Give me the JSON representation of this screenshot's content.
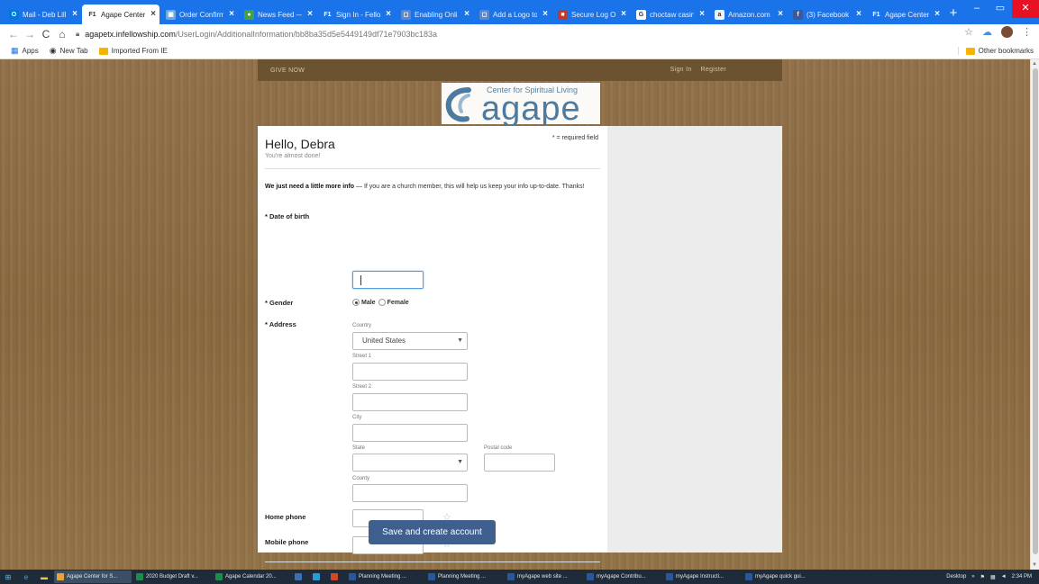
{
  "browser": {
    "tabs": [
      {
        "label": "Mail - Deb Lill",
        "icon_color": "#0078d4",
        "icon_char": "O"
      },
      {
        "label": "Agape Center f",
        "icon_color": "#ffffff",
        "icon_char": "F1",
        "active": true
      },
      {
        "label": "Order Confirm",
        "icon_color": "#6fa8dc",
        "icon_char": "▣"
      },
      {
        "label": "News Feed —",
        "icon_color": "#43a047",
        "icon_char": "●"
      },
      {
        "label": "Sign In - Fello",
        "icon_color": "#1a73e8",
        "icon_char": "F1"
      },
      {
        "label": "Enabling Onli",
        "icon_color": "#5f87c8",
        "icon_char": "◻"
      },
      {
        "label": "Add a Logo to",
        "icon_color": "#5f87c8",
        "icon_char": "◻"
      },
      {
        "label": "Secure Log Of",
        "icon_color": "#c0392b",
        "icon_char": "■"
      },
      {
        "label": "choctaw casin",
        "icon_color": "#ffffff",
        "icon_char": "G"
      },
      {
        "label": "Amazon.com",
        "icon_color": "#f3f3f3",
        "icon_char": "a"
      },
      {
        "label": "(3) Facebook",
        "icon_color": "#3b5998",
        "icon_char": "f"
      },
      {
        "label": "Agape Center",
        "icon_color": "#1a73e8",
        "icon_char": "F1"
      }
    ],
    "new_tab": "+",
    "window_controls": {
      "minimize": "–",
      "maximize": "▭",
      "close": "✕"
    },
    "nav": {
      "back": "←",
      "forward": "→",
      "reload": "C",
      "home": "⌂"
    },
    "url_host": "agapetx.infellowship.com",
    "url_path": "/UserLogin/AdditionalInformation/bb8ba35d5e5449149df71e7903bc183a",
    "bookmarks": [
      {
        "label": "Apps",
        "icon": "apps-grid-icon"
      },
      {
        "label": "New Tab",
        "icon": "globe-icon"
      },
      {
        "label": "Imported From IE",
        "icon": "folder-icon"
      }
    ],
    "other_bookmarks": "Other bookmarks"
  },
  "site": {
    "give_now": "GIVE NOW",
    "sign_in": "Sign In",
    "register": "Register",
    "logo_tagline": "Center for Spiritual Living",
    "logo_word": "agape"
  },
  "form": {
    "greeting": "Hello, Debra",
    "subgreeting": "You're almost done!",
    "required_note": "* = required field",
    "intro_bold": "We just need a little more info",
    "intro_rest": " — If you are a church member, this will help us keep your info up-to-date. Thanks!",
    "dob_label": "* Date of birth",
    "dob_value": "",
    "gender_label": "* Gender",
    "gender_options": [
      "Male",
      "Female"
    ],
    "gender_selected": "Male",
    "address_label": "* Address",
    "country_label": "Country",
    "country_value": "United States",
    "street1_label": "Street 1",
    "street2_label": "Street 2",
    "city_label": "City",
    "state_label": "State",
    "state_value": "",
    "postal_label": "Postal code",
    "county_label": "County",
    "home_phone_label": "Home phone",
    "mobile_phone_label": "Mobile phone",
    "submit_label": "Save and create account"
  },
  "taskbar": {
    "items": [
      {
        "label": "Agape Center for S...",
        "icon_color": "#e8a33c",
        "active": true
      },
      {
        "label": "2020 Budget Draft v...",
        "icon_color": "#1d8c4a"
      },
      {
        "label": "Agape Calendar 20...",
        "icon_color": "#1d8c4a"
      },
      {
        "label": "",
        "icon_color": "#3c6eb4"
      },
      {
        "label": "",
        "icon_color": "#2a9bd6"
      },
      {
        "label": "",
        "icon_color": "#d24726"
      },
      {
        "label": "Planning Meeting ...",
        "icon_color": "#2b579a"
      },
      {
        "label": "Planning Meeting ...",
        "icon_color": "#2b579a"
      },
      {
        "label": "myAgape web site ...",
        "icon_color": "#2b579a"
      },
      {
        "label": "myAgape Contribu...",
        "icon_color": "#2b579a"
      },
      {
        "label": "myAgape Instructi...",
        "icon_color": "#2b579a"
      },
      {
        "label": "myAgape quick gui...",
        "icon_color": "#2b579a"
      }
    ],
    "desktop_label": "Desktop",
    "clock": "2:34 PM"
  },
  "colors": {
    "chrome_blue": "#1a73e8",
    "page_wood": "#8b6a3e",
    "button_blue": "#3f5f8f",
    "logo_blue": "#4c7b9f"
  }
}
